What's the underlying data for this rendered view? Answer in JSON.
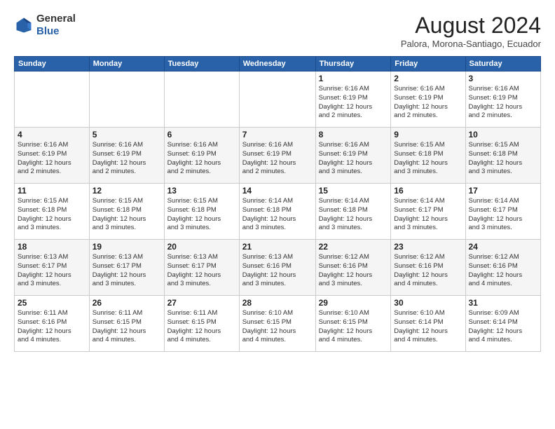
{
  "header": {
    "logo_general": "General",
    "logo_blue": "Blue",
    "month": "August 2024",
    "location": "Palora, Morona-Santiago, Ecuador"
  },
  "weekdays": [
    "Sunday",
    "Monday",
    "Tuesday",
    "Wednesday",
    "Thursday",
    "Friday",
    "Saturday"
  ],
  "weeks": [
    [
      {
        "day": "",
        "info": ""
      },
      {
        "day": "",
        "info": ""
      },
      {
        "day": "",
        "info": ""
      },
      {
        "day": "",
        "info": ""
      },
      {
        "day": "1",
        "info": "Sunrise: 6:16 AM\nSunset: 6:19 PM\nDaylight: 12 hours\nand 2 minutes."
      },
      {
        "day": "2",
        "info": "Sunrise: 6:16 AM\nSunset: 6:19 PM\nDaylight: 12 hours\nand 2 minutes."
      },
      {
        "day": "3",
        "info": "Sunrise: 6:16 AM\nSunset: 6:19 PM\nDaylight: 12 hours\nand 2 minutes."
      }
    ],
    [
      {
        "day": "4",
        "info": "Sunrise: 6:16 AM\nSunset: 6:19 PM\nDaylight: 12 hours\nand 2 minutes."
      },
      {
        "day": "5",
        "info": "Sunrise: 6:16 AM\nSunset: 6:19 PM\nDaylight: 12 hours\nand 2 minutes."
      },
      {
        "day": "6",
        "info": "Sunrise: 6:16 AM\nSunset: 6:19 PM\nDaylight: 12 hours\nand 2 minutes."
      },
      {
        "day": "7",
        "info": "Sunrise: 6:16 AM\nSunset: 6:19 PM\nDaylight: 12 hours\nand 2 minutes."
      },
      {
        "day": "8",
        "info": "Sunrise: 6:16 AM\nSunset: 6:19 PM\nDaylight: 12 hours\nand 3 minutes."
      },
      {
        "day": "9",
        "info": "Sunrise: 6:15 AM\nSunset: 6:18 PM\nDaylight: 12 hours\nand 3 minutes."
      },
      {
        "day": "10",
        "info": "Sunrise: 6:15 AM\nSunset: 6:18 PM\nDaylight: 12 hours\nand 3 minutes."
      }
    ],
    [
      {
        "day": "11",
        "info": "Sunrise: 6:15 AM\nSunset: 6:18 PM\nDaylight: 12 hours\nand 3 minutes."
      },
      {
        "day": "12",
        "info": "Sunrise: 6:15 AM\nSunset: 6:18 PM\nDaylight: 12 hours\nand 3 minutes."
      },
      {
        "day": "13",
        "info": "Sunrise: 6:15 AM\nSunset: 6:18 PM\nDaylight: 12 hours\nand 3 minutes."
      },
      {
        "day": "14",
        "info": "Sunrise: 6:14 AM\nSunset: 6:18 PM\nDaylight: 12 hours\nand 3 minutes."
      },
      {
        "day": "15",
        "info": "Sunrise: 6:14 AM\nSunset: 6:18 PM\nDaylight: 12 hours\nand 3 minutes."
      },
      {
        "day": "16",
        "info": "Sunrise: 6:14 AM\nSunset: 6:17 PM\nDaylight: 12 hours\nand 3 minutes."
      },
      {
        "day": "17",
        "info": "Sunrise: 6:14 AM\nSunset: 6:17 PM\nDaylight: 12 hours\nand 3 minutes."
      }
    ],
    [
      {
        "day": "18",
        "info": "Sunrise: 6:13 AM\nSunset: 6:17 PM\nDaylight: 12 hours\nand 3 minutes."
      },
      {
        "day": "19",
        "info": "Sunrise: 6:13 AM\nSunset: 6:17 PM\nDaylight: 12 hours\nand 3 minutes."
      },
      {
        "day": "20",
        "info": "Sunrise: 6:13 AM\nSunset: 6:17 PM\nDaylight: 12 hours\nand 3 minutes."
      },
      {
        "day": "21",
        "info": "Sunrise: 6:13 AM\nSunset: 6:16 PM\nDaylight: 12 hours\nand 3 minutes."
      },
      {
        "day": "22",
        "info": "Sunrise: 6:12 AM\nSunset: 6:16 PM\nDaylight: 12 hours\nand 3 minutes."
      },
      {
        "day": "23",
        "info": "Sunrise: 6:12 AM\nSunset: 6:16 PM\nDaylight: 12 hours\nand 4 minutes."
      },
      {
        "day": "24",
        "info": "Sunrise: 6:12 AM\nSunset: 6:16 PM\nDaylight: 12 hours\nand 4 minutes."
      }
    ],
    [
      {
        "day": "25",
        "info": "Sunrise: 6:11 AM\nSunset: 6:16 PM\nDaylight: 12 hours\nand 4 minutes."
      },
      {
        "day": "26",
        "info": "Sunrise: 6:11 AM\nSunset: 6:15 PM\nDaylight: 12 hours\nand 4 minutes."
      },
      {
        "day": "27",
        "info": "Sunrise: 6:11 AM\nSunset: 6:15 PM\nDaylight: 12 hours\nand 4 minutes."
      },
      {
        "day": "28",
        "info": "Sunrise: 6:10 AM\nSunset: 6:15 PM\nDaylight: 12 hours\nand 4 minutes."
      },
      {
        "day": "29",
        "info": "Sunrise: 6:10 AM\nSunset: 6:15 PM\nDaylight: 12 hours\nand 4 minutes."
      },
      {
        "day": "30",
        "info": "Sunrise: 6:10 AM\nSunset: 6:14 PM\nDaylight: 12 hours\nand 4 minutes."
      },
      {
        "day": "31",
        "info": "Sunrise: 6:09 AM\nSunset: 6:14 PM\nDaylight: 12 hours\nand 4 minutes."
      }
    ]
  ]
}
